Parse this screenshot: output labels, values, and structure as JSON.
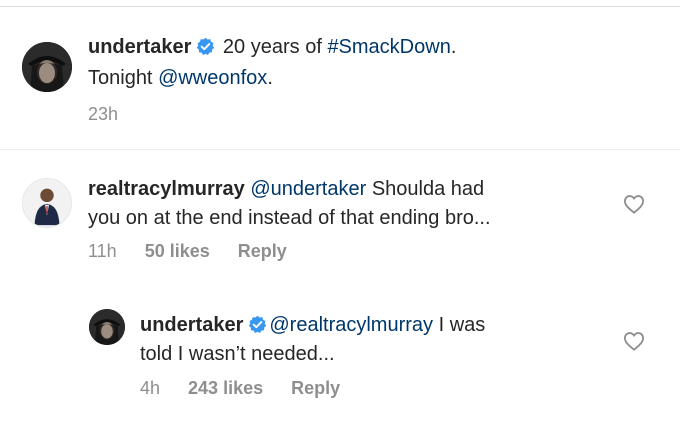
{
  "post": {
    "username": "undertaker",
    "verified": true,
    "caption_text": " 20 years of ",
    "caption_hashtag": "#SmackDown",
    "caption_after_hashtag": ".",
    "caption_line2_text": "Tonight ",
    "caption_mention": "@wweonfox",
    "caption_end": ".",
    "time": "23h"
  },
  "comments": [
    {
      "username": "realtracylmurray",
      "verified": false,
      "mention": "@undertaker",
      "text_line1": " Shoulda had",
      "text_line2": "you on at the end instead of that ending bro...",
      "time": "11h",
      "likes": "50 likes",
      "reply": "Reply"
    },
    {
      "username": "undertaker",
      "verified": true,
      "mention": "@realtracylmurray",
      "text_line1": " I was",
      "text_line2": "told I wasn’t needed...",
      "time": "4h",
      "likes": "243 likes",
      "reply": "Reply"
    }
  ],
  "icons": {
    "verified": "verified-badge-icon",
    "like": "heart-outline-icon"
  },
  "colors": {
    "username": "#262626",
    "link": "#00376b",
    "meta": "#8e8e8e",
    "verified": "#3897f0"
  }
}
